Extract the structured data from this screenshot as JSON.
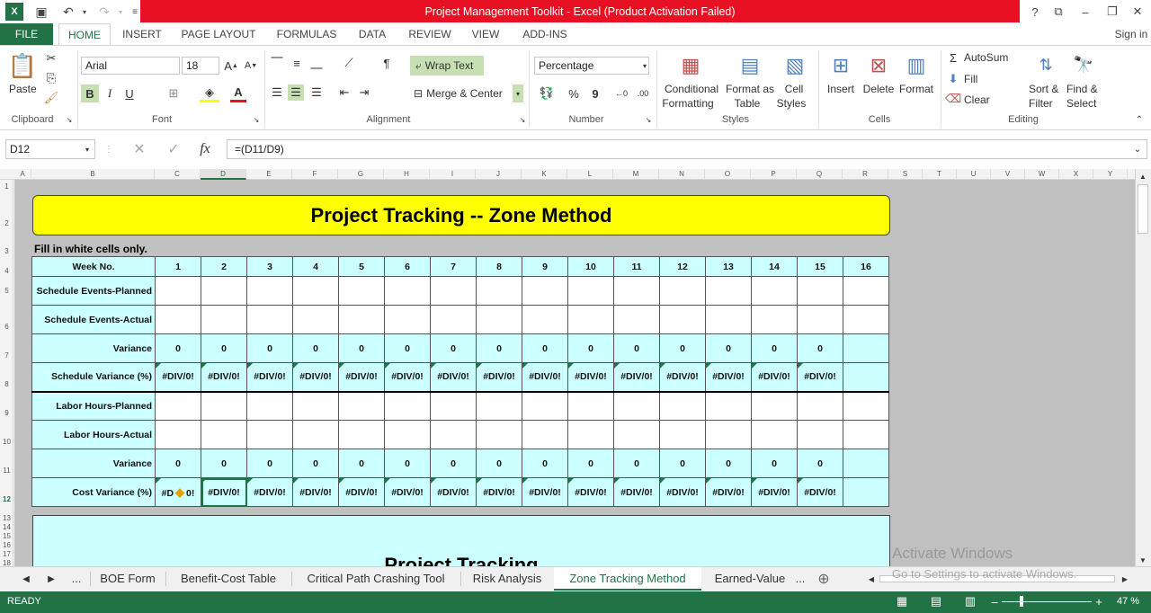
{
  "window": {
    "title": "Project Management Toolkit -  Excel (Product Activation Failed)",
    "help": "?",
    "sign_in": "Sign in"
  },
  "ribbon_tabs": [
    "FILE",
    "HOME",
    "INSERT",
    "PAGE LAYOUT",
    "FORMULAS",
    "DATA",
    "REVIEW",
    "VIEW",
    "ADD-INS"
  ],
  "ribbon": {
    "clipboard": {
      "paste": "Paste",
      "label": "Clipboard"
    },
    "font": {
      "name": "Arial",
      "size": "18",
      "bold": "B",
      "italic": "I",
      "underline": "U",
      "label": "Font"
    },
    "alignment": {
      "wrap_text": "Wrap Text",
      "merge_center": "Merge & Center",
      "label": "Alignment"
    },
    "number": {
      "format": "Percentage",
      "percent": "%",
      "comma": "9",
      "label": "Number"
    },
    "styles": {
      "conditional_1": "Conditional",
      "conditional_2": "Formatting",
      "format_table_1": "Format as",
      "format_table_2": "Table",
      "cell_styles_1": "Cell",
      "cell_styles_2": "Styles",
      "label": "Styles"
    },
    "cells": {
      "insert": "Insert",
      "delete": "Delete",
      "format": "Format",
      "label": "Cells"
    },
    "editing": {
      "autosum": "AutoSum",
      "fill": "Fill",
      "clear": "Clear",
      "sort_1": "Sort &",
      "sort_2": "Filter",
      "find_1": "Find &",
      "find_2": "Select",
      "label": "Editing"
    }
  },
  "formula_bar": {
    "name_box": "D12",
    "formula": "=(D11/D9)",
    "fx": "fx"
  },
  "columns": [
    "A",
    "B",
    "C",
    "D",
    "E",
    "F",
    "G",
    "H",
    "I",
    "J",
    "K",
    "L",
    "M",
    "N",
    "O",
    "P",
    "Q",
    "R",
    "S",
    "T",
    "U",
    "V",
    "W",
    "X",
    "Y"
  ],
  "rows": [
    "1",
    "2",
    "3",
    "4",
    "5",
    "6",
    "7",
    "8",
    "9",
    "10",
    "11",
    "12",
    "13",
    "14",
    "15",
    "16",
    "17",
    "18"
  ],
  "sheet": {
    "banner": "Project Tracking -- Zone Method",
    "fill_note": "Fill in white cells only.",
    "week_label": "Week No.",
    "weeks": [
      "1",
      "2",
      "3",
      "4",
      "5",
      "6",
      "7",
      "8",
      "9",
      "10",
      "11",
      "12",
      "13",
      "14",
      "15",
      "16"
    ],
    "row_labels": {
      "sched_planned": "Schedule Events-Planned",
      "sched_actual": "Schedule Events-Actual",
      "variance": "Variance",
      "sched_var_pct": "Schedule Variance (%)",
      "labor_planned": "Labor Hours-Planned",
      "labor_actual": "Labor Hours-Actual",
      "variance2": "Variance",
      "cost_var_pct": "Cost Variance (%)"
    },
    "zero": "0",
    "div_error": "#DIV/0!",
    "partial_error": "#D",
    "partial_error_tail": "0!",
    "second_title": "Project Tracking"
  },
  "sheet_tabs": [
    "BOE Form",
    "Benefit-Cost Table",
    "Critical Path Crashing Tool",
    "Risk Analysis",
    "Zone Tracking Method",
    "Earned-Value"
  ],
  "sheet_nav": {
    "more": "...",
    "more_right": "..."
  },
  "status": {
    "ready": "READY",
    "zoom": "47 %"
  },
  "watermark": {
    "line1": "Activate Windows",
    "line2": "Go to Settings to activate Windows."
  }
}
